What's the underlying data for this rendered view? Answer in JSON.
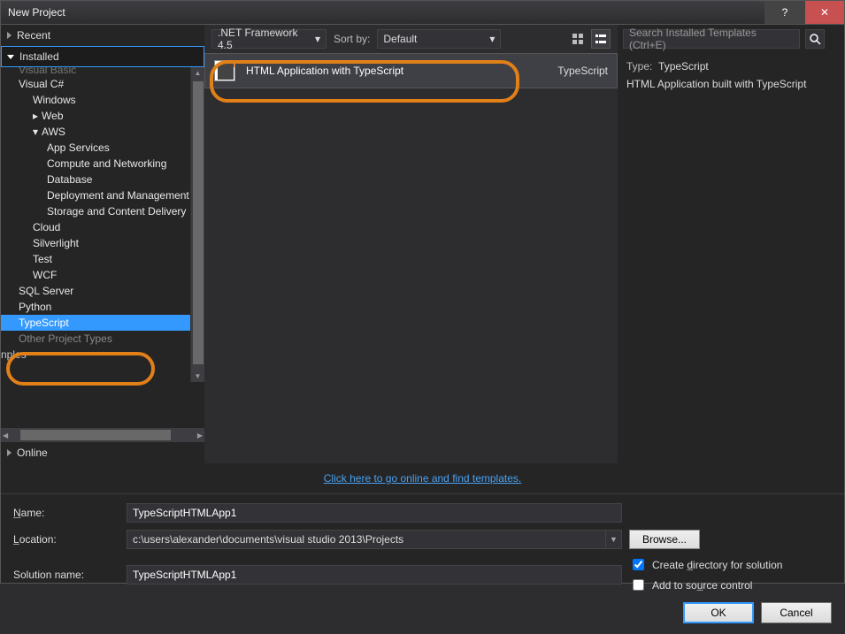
{
  "titlebar": {
    "title": "New Project"
  },
  "left": {
    "recent_label": "Recent",
    "installed_label": "Installed",
    "online_label": "Online",
    "tree": {
      "top_cut": "Visual Basic",
      "vc": "Visual C#",
      "windows": "Windows",
      "web": "Web",
      "aws": "AWS",
      "aws_app": "App Services",
      "aws_cn": "Compute and Networking",
      "aws_db": "Database",
      "aws_dm": "Deployment and Management",
      "aws_st": "Storage and Content Delivery",
      "cloud": "Cloud",
      "silverlight": "Silverlight",
      "test": "Test",
      "wcf": "WCF",
      "sql": "SQL Server",
      "python": "Python",
      "typescript": "TypeScript",
      "other": "Other Project Types",
      "nples": "nples"
    }
  },
  "middle": {
    "framework": ".NET Framework 4.5",
    "sort_label": "Sort by:",
    "sort_value": "Default",
    "template_name": "HTML Application with TypeScript",
    "template_lang": "TypeScript",
    "go_online": "Click here to go online and find templates."
  },
  "right": {
    "search_placeholder": "Search Installed Templates (Ctrl+E)",
    "type_label": "Type:",
    "type_value": "TypeScript",
    "desc": "HTML Application built with TypeScript"
  },
  "bottom": {
    "name_label": "Name:",
    "name_value": "TypeScriptHTMLApp1",
    "location_label": "Location:",
    "location_value": "c:\\users\\alexander\\documents\\visual studio 2013\\Projects",
    "browse_label": "Browse...",
    "solution_label": "Solution name:",
    "solution_value": "TypeScriptHTMLApp1",
    "create_dir_label": "Create directory for solution",
    "source_ctrl_label": "Add to source control",
    "ok": "OK",
    "cancel": "Cancel"
  }
}
